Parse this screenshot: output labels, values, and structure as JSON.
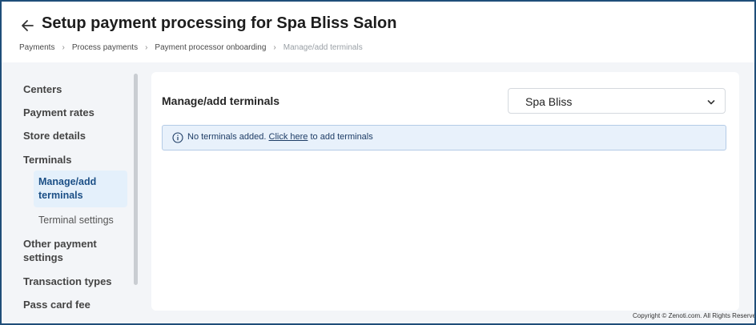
{
  "header": {
    "title": "Setup payment processing for Spa Bliss Salon",
    "breadcrumbs": [
      "Payments",
      "Process payments",
      "Payment processor onboarding",
      "Manage/add terminals"
    ]
  },
  "sidebar": {
    "items": [
      {
        "label": "Centers"
      },
      {
        "label": "Payment rates"
      },
      {
        "label": "Store details"
      },
      {
        "label": "Terminals"
      },
      {
        "label": "Manage/add terminals",
        "active": true
      },
      {
        "label": "Terminal settings"
      },
      {
        "label": "Other payment settings"
      },
      {
        "label": "Transaction types"
      },
      {
        "label": "Pass card fee"
      }
    ]
  },
  "main": {
    "title": "Manage/add terminals",
    "center_select": {
      "value": "Spa Bliss"
    },
    "alert": {
      "prefix": "No terminals added.",
      "link": "Click here",
      "suffix": "to add terminals"
    }
  },
  "footer": {
    "copyright": "Copyright © Zenoti.com. All Rights Reserved"
  },
  "colors": {
    "frame_border": "#1f4e79",
    "active_bg": "#e4f0fb",
    "active_text": "#1b4f86",
    "alert_bg": "#e8f1fb"
  },
  "icons": [
    "back-arrow-icon",
    "breadcrumb-chevron-icon",
    "chevron-down-icon",
    "info-icon"
  ]
}
